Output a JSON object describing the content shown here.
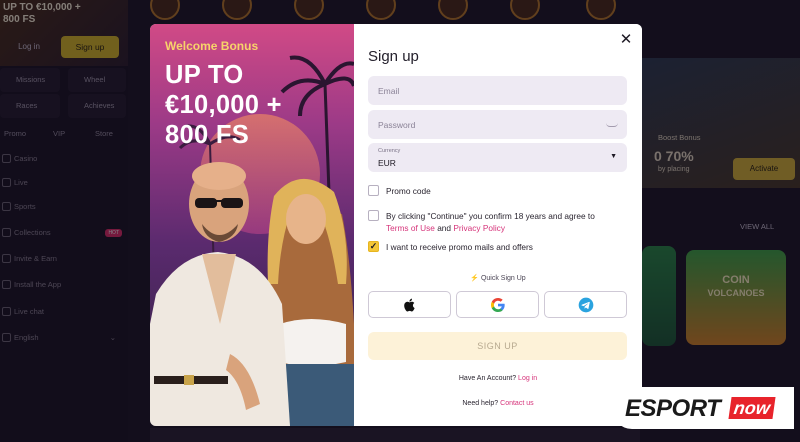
{
  "background": {
    "sidebar": {
      "promo": "UP TO €10,000 + 800 FS",
      "login": "Log in",
      "signup": "Sign up",
      "tiles": [
        "Missions",
        "Wheel",
        "Races",
        "Achieves"
      ],
      "tabs": [
        "Promo",
        "VIP",
        "Store"
      ],
      "items": [
        "Casino",
        "Live",
        "Sports",
        "Collections",
        "Invite & Earn",
        "Install the App",
        "Live chat",
        "English"
      ],
      "hot_badge": "HOT"
    },
    "right_banner": {
      "line1": "Boost Bonus",
      "line2": "0 70%",
      "line3": "by placing",
      "activate": "Activate"
    },
    "view_all": "VIEW ALL",
    "game_tile": {
      "line1": "COIN",
      "line2": "VOLCANOES"
    }
  },
  "promo": {
    "kicker": "Welcome Bonus",
    "headline_1": "UP TO",
    "headline_2": "€10,000 +",
    "headline_3": "800 FS"
  },
  "form": {
    "title": "Sign up",
    "email_placeholder": "Email",
    "password_placeholder": "Password",
    "currency_label": "Currency",
    "currency_value": "EUR",
    "promo_code": "Promo code",
    "terms_text_1": "By clicking \"Continue\" you confirm 18 years and agree to",
    "terms_link": "Terms of Use",
    "terms_and": "and",
    "privacy_link": "Privacy Policy",
    "promo_mails": "I want to receive promo mails and offers",
    "promo_mails_checked": true,
    "quick_signup": "Quick Sign Up",
    "submit": "SIGN UP",
    "have_account": "Have An Account?",
    "login_link": "Log in",
    "need_help": "Need help?",
    "contact_link": "Contact us"
  },
  "colors": {
    "accent_pink": "#d6337a",
    "checkbox_yellow": "#f4c636",
    "submit_bg": "#fdf2d8"
  },
  "watermark": {
    "part1": "ESPORT",
    "part2": "now"
  }
}
